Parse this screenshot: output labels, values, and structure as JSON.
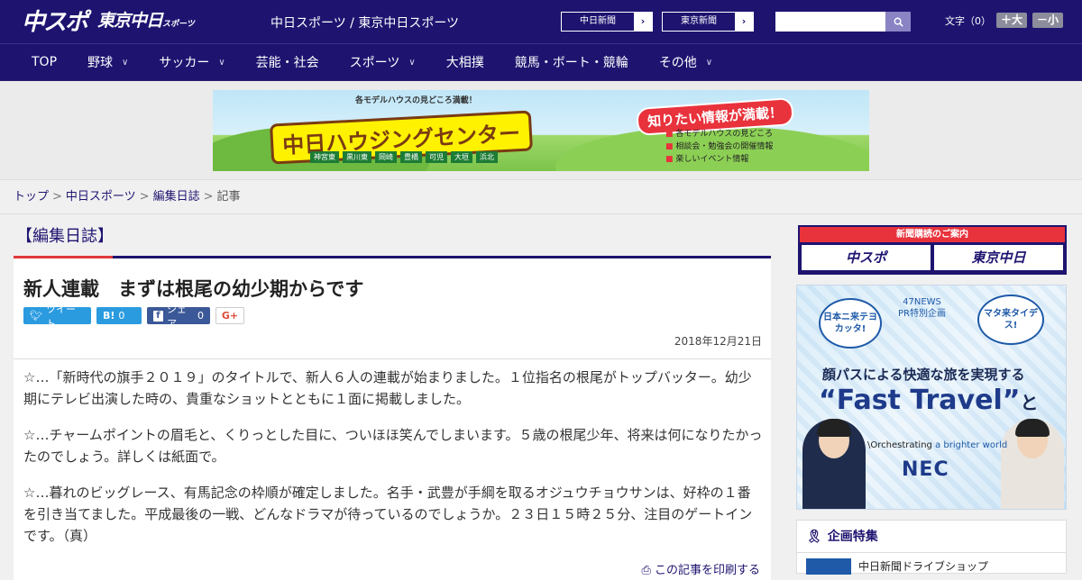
{
  "header": {
    "logo_main": "中スポ",
    "logo_sub": "東京中日",
    "logo_sub_small": "スポーツ",
    "site_name": "中日スポーツ / 東京中日スポーツ",
    "paper_links": [
      {
        "label": "中日新聞"
      },
      {
        "label": "東京新聞"
      }
    ],
    "search": {
      "placeholder": "",
      "value": ""
    },
    "font_size": {
      "label": "文字（0）",
      "increase": "＋大",
      "decrease": "－小"
    }
  },
  "nav": [
    {
      "label": "TOP",
      "dropdown": false
    },
    {
      "label": "野球",
      "dropdown": true
    },
    {
      "label": "サッカー",
      "dropdown": true
    },
    {
      "label": "芸能・社会",
      "dropdown": false
    },
    {
      "label": "スポーツ",
      "dropdown": true
    },
    {
      "label": "大相撲",
      "dropdown": false
    },
    {
      "label": "競馬・ボート・競輪",
      "dropdown": false
    },
    {
      "label": "その他",
      "dropdown": true
    }
  ],
  "banner_ad": {
    "top_note": "各モデルハウスの見どころ満載！",
    "title": "中日ハウジングセンター",
    "tags": [
      "神宮東",
      "黒川東",
      "岡崎",
      "豊橋",
      "可児",
      "大垣",
      "浜北"
    ],
    "badge": "知りたい情報が満載！",
    "lines": [
      "各モデルハウスの見どころ",
      "相談会・勉強会の開催情報",
      "楽しいイベント情報"
    ]
  },
  "breadcrumb": {
    "items": [
      "トップ",
      "中日スポーツ",
      "編集日誌"
    ],
    "current": "記事"
  },
  "section_title": "【編集日誌】",
  "article": {
    "headline": "新人連載　まずは根尾の幼少期からです",
    "share": {
      "tweet": "ツイート",
      "hatena_label": "B!",
      "hatena_count": "0",
      "facebook_label": "シェア",
      "facebook_count": "0",
      "gplus": "G+"
    },
    "date": "2018年12月21日",
    "paragraphs": [
      "☆…「新時代の旗手２０１９」のタイトルで、新人６人の連載が始まりました。１位指名の根尾がトップバッター。幼少期にテレビ出演した時の、貴重なショットとともに１面に掲載しました。",
      "☆…チャームポイントの眉毛と、くりっとした目に、ついほほ笑んでしまいます。５歳の根尾少年、将来は何になりたかったのでしょう。詳しくは紙面で。",
      "☆…暮れのビッグレース、有馬記念の枠順が確定しました。名手・武豊が手綱を取るオジュウチョウサンは、好枠の１番を引き当てました。平成最後の一戦、どんなドラマが待っているのでしょうか。２３日１５時２５分、注目のゲートインです。（真）"
    ],
    "print_link": "この記事を印刷する"
  },
  "sidebar": {
    "subscription": {
      "head": "新聞購読のご案内",
      "logo1": "中スポ",
      "logo2": "東京中日"
    },
    "ad": {
      "pr_line1": "47NEWS",
      "pr_line2": "PR特別企画",
      "bubble_left": "日本ニ来テヨカッタ!",
      "bubble_right": "マタ来タイデス!",
      "headline": "顔パスによる快適な旅を実現する",
      "ft_main": "“Fast Travel”",
      "ft_suffix": "とは?",
      "orch_prefix": "\\Orchestrating",
      "orch_suffix": "a brighter world",
      "brand": "NEC"
    },
    "feature": {
      "title": "企画特集",
      "item": "中日新聞ドライブショップ"
    }
  },
  "colors": {
    "brand_navy": "#1e1470",
    "accent_red": "#e03a3a",
    "twitter": "#2b9be0",
    "facebook": "#3b5998"
  }
}
